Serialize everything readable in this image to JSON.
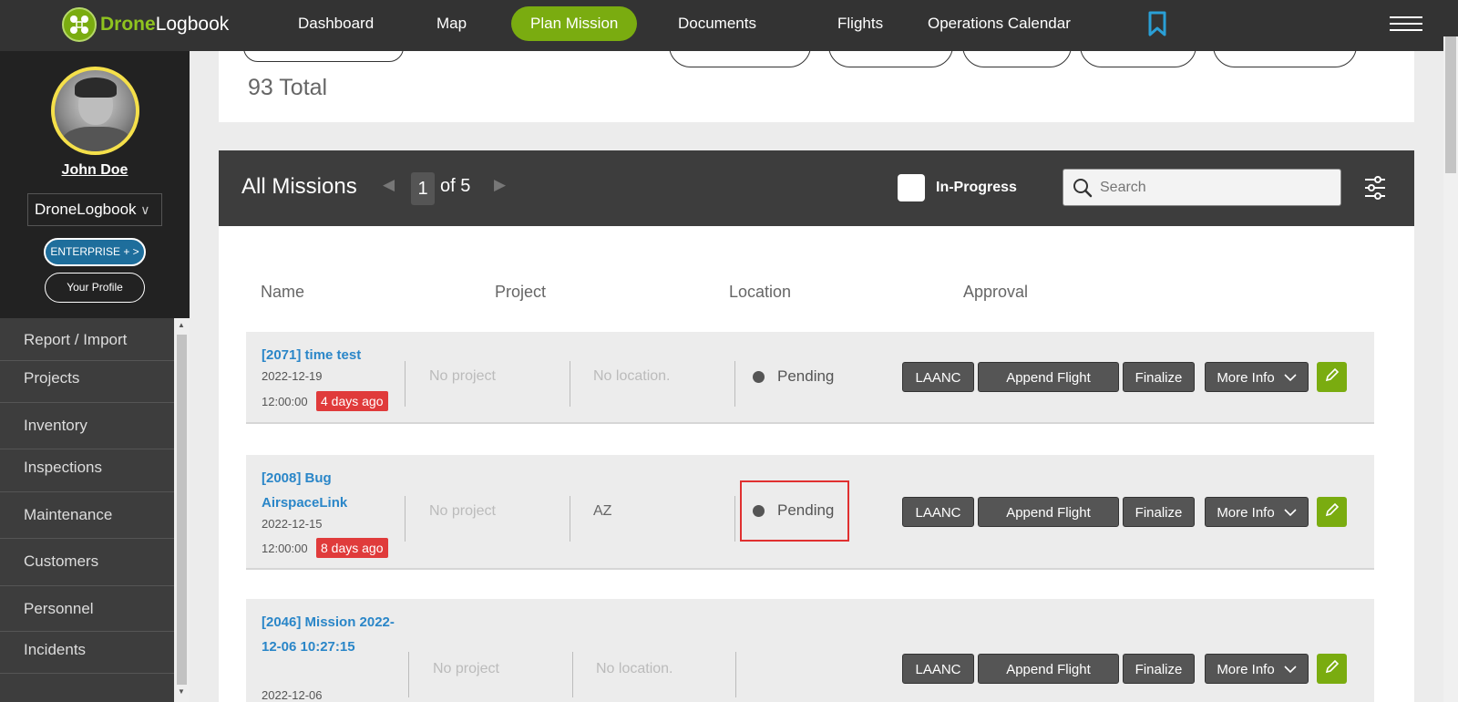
{
  "app": {
    "logo_part1": "Drone",
    "logo_part2": "Logbook"
  },
  "nav": {
    "dashboard": "Dashboard",
    "map": "Map",
    "plan_mission": "Plan Mission",
    "documents": "Documents",
    "flights": "Flights",
    "operations_calendar": "Operations Calendar"
  },
  "sidebar": {
    "user_name": "John Doe",
    "org": "DroneLogbook",
    "org_chevron": "∨",
    "enterprise": "ENTERPRISE + >",
    "your_profile": "Your Profile",
    "menu": [
      "Report / Import",
      "Projects",
      "Inventory",
      "Inspections",
      "Maintenance",
      "Customers",
      "Personnel",
      "Incidents"
    ]
  },
  "summary": {
    "total": "93 Total"
  },
  "missions": {
    "title": "All Missions",
    "page": "1",
    "of_pages": "of 5",
    "in_progress_label": "In-Progress",
    "search_placeholder": "Search",
    "columns": {
      "name": "Name",
      "project": "Project",
      "location": "Location",
      "approval": "Approval"
    },
    "actions": {
      "laanc": "LAANC",
      "append_flight": "Append Flight",
      "finalize": "Finalize",
      "more_info": "More Info"
    },
    "rows": [
      {
        "name": "[2071] time test",
        "date": "2022-12-19",
        "time": "12:00:00",
        "ago": "4 days ago",
        "project": "No project",
        "location": "No location.",
        "approval": "Pending"
      },
      {
        "name": "[2008] Bug AirspaceLink",
        "date": "2022-12-15",
        "time": "12:00:00",
        "ago": "8 days ago",
        "project": "No project",
        "location": "AZ",
        "approval": "Pending"
      },
      {
        "name": "[2046] Mission 2022-12-06 10:27:15",
        "date": "2022-12-06",
        "project": "No project",
        "location": "No location."
      }
    ]
  },
  "colors": {
    "accent_green": "#7aac10",
    "link_blue": "#2a86c8",
    "badge_red": "#e03b3b",
    "highlight_red": "#e03030"
  },
  "icons": [
    "drone-logo-icon",
    "bookmark-icon",
    "hamburger-icon",
    "search-icon",
    "filter-sliders-icon",
    "chevron-down-icon",
    "pencil-icon",
    "triangle-left-icon",
    "triangle-right-icon"
  ]
}
